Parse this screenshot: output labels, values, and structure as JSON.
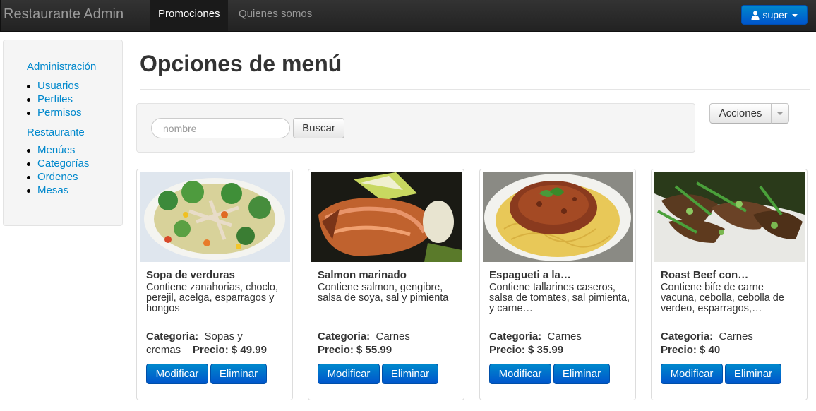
{
  "navbar": {
    "brand": "Restaurante Admin",
    "links": [
      {
        "label": "Promociones"
      },
      {
        "label": "Quienes somos"
      }
    ],
    "user_label": "super"
  },
  "sidebar": {
    "sections": [
      {
        "header": "Administración",
        "items": [
          "Usuarios",
          "Perfiles",
          "Permisos"
        ]
      },
      {
        "header": "Restaurante",
        "items": [
          "Menúes",
          "Categorías",
          "Ordenes",
          "Mesas"
        ]
      }
    ]
  },
  "main": {
    "title": "Opciones de menú",
    "search": {
      "placeholder": "nombre",
      "value": "",
      "button_label": "Buscar"
    },
    "actions_label": "Acciones"
  },
  "labels": {
    "category": "Categoria:",
    "price": "Precio:",
    "modify": "Modificar",
    "delete": "Eliminar"
  },
  "cards": [
    {
      "name": "Sopa de verduras",
      "description": "Contiene zanahorias, choclo, perejil, acelga, esparragos y hongos",
      "category": "Sopas y cremas",
      "price": "$ 49.99",
      "image": "vegetable-soup"
    },
    {
      "name": "Salmon marinado",
      "description": "Contiene salmon, gengibre, salsa de soya, sal y pimienta",
      "category": "Carnes",
      "price": "$ 55.99",
      "image": "marinated-salmon"
    },
    {
      "name": "Espagueti a la…",
      "description": "Contiene tallarines caseros, salsa de tomates, sal pimienta, y carne…",
      "category": "Carnes",
      "price": "$ 35.99",
      "image": "spaghetti-bolognese"
    },
    {
      "name": "Roast Beef con…",
      "description": "Contiene bife de carne vacuna, cebolla, cebolla de verdeo, esparragos,…",
      "category": "Carnes",
      "price": "$ 40",
      "image": "roast-beef"
    }
  ],
  "colors": {
    "navbar": "#222222",
    "primary": "#0066cc",
    "link": "#0088cc",
    "well": "#f5f5f5"
  }
}
